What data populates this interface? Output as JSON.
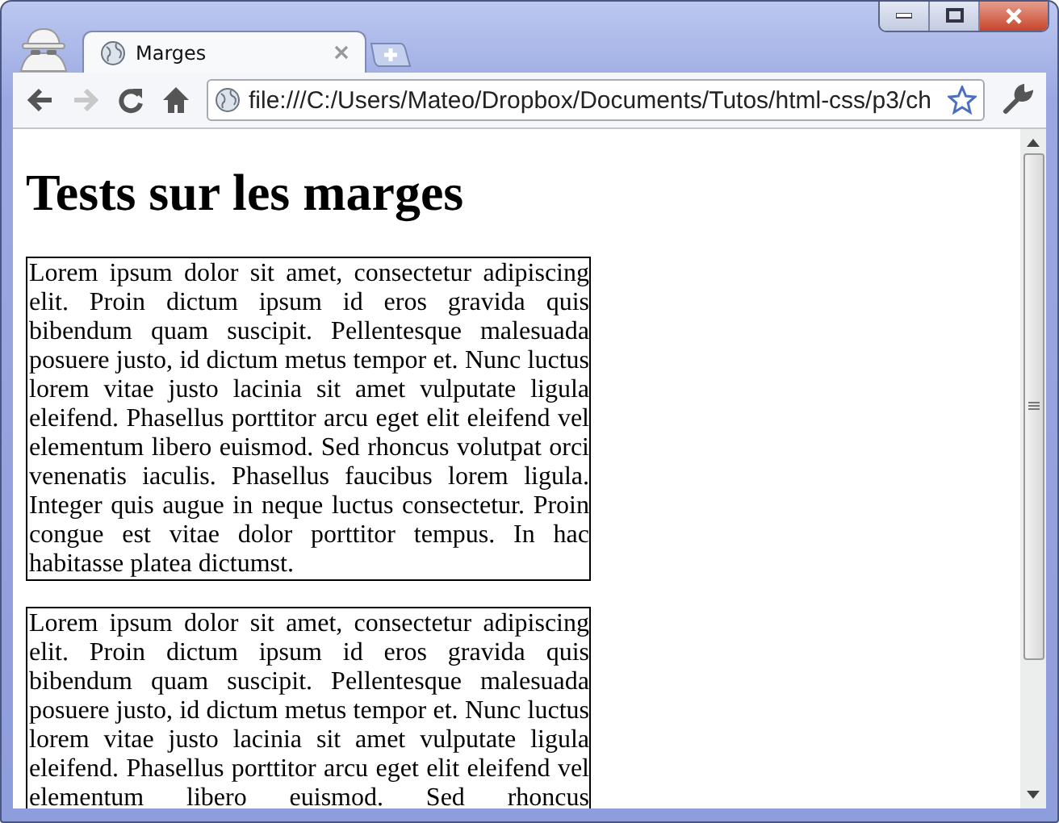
{
  "tabs": [
    {
      "label": "Marges",
      "selected": true
    }
  ],
  "toolbar": {
    "back_disabled": false,
    "forward_disabled": true,
    "address": "file:///C:/Users/Mateo/Dropbox/Documents/Tutos/html-css/p3/ch"
  },
  "page": {
    "heading": "Tests sur les marges",
    "paragraphs": [
      {
        "text": "Lorem ipsum dolor sit amet, consectetur adipiscing elit. Proin dictum ipsum id eros gravida quis bibendum quam suscipit. Pellentesque malesuada posuere justo, id dictum metus tempor et. Nunc luctus lorem vitae justo lacinia sit amet vulputate ligula eleifend. Phasellus porttitor arcu eget elit eleifend vel elementum libero euismod. Sed rhoncus volutpat orci venenatis iaculis. Phasellus faucibus lorem ligula. Integer quis augue in neque luctus consectetur. Proin congue est vitae dolor porttitor tempus. In hac habitasse platea dictumst.",
        "cut_off": false
      },
      {
        "text": "Lorem ipsum dolor sit amet, consectetur adipiscing elit. Proin dictum ipsum id eros gravida quis bibendum quam suscipit. Pellentesque malesuada posuere justo, id dictum metus tempor et. Nunc luctus lorem vitae justo lacinia sit amet vulputate ligula eleifend. Phasellus porttitor arcu eget elit eleifend vel elementum libero euismod. Sed rhoncus",
        "cut_off": true
      }
    ]
  }
}
